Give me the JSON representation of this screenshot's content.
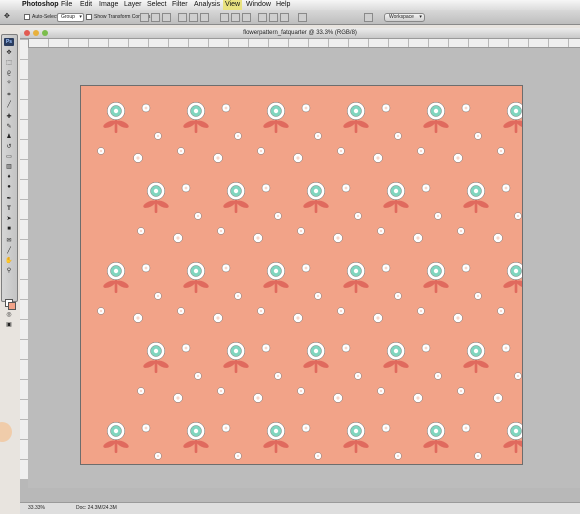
{
  "menubar": {
    "app": "Photoshop",
    "items": [
      "File",
      "Edit",
      "Image",
      "Layer",
      "Select",
      "Filter",
      "Analysis",
      "View",
      "Window",
      "Help"
    ],
    "active_item": "View"
  },
  "options": {
    "auto_select_label": "Auto-Select:",
    "auto_select_value": "Group",
    "transform_label": "Show Transform Controls",
    "workspace_label": "Workspace"
  },
  "toolbox": {
    "logo": "Ps",
    "tools": [
      "move-icon",
      "marquee-icon",
      "lasso-icon",
      "magic-wand-icon",
      "crop-icon",
      "eyedropper-icon",
      "healing-icon",
      "brush-icon",
      "clone-stamp-icon",
      "history-brush-icon",
      "eraser-icon",
      "gradient-icon",
      "blur-icon",
      "dodge-icon",
      "pen-icon",
      "type-icon",
      "path-select-icon",
      "shape-icon",
      "notes-icon",
      "eyedropper2-icon",
      "hand-icon",
      "zoom-icon"
    ]
  },
  "document": {
    "title": "flowerpattern_fatquarter @ 33.3% (RGB/8)",
    "zoom": "33.33%",
    "doc_size": "Doc: 24.3M/24.3M"
  },
  "colors": {
    "canvas_bg": "#f2a388",
    "petal": "#ffffff",
    "center": "#7fd6c0",
    "stem": "#e06a5e"
  }
}
